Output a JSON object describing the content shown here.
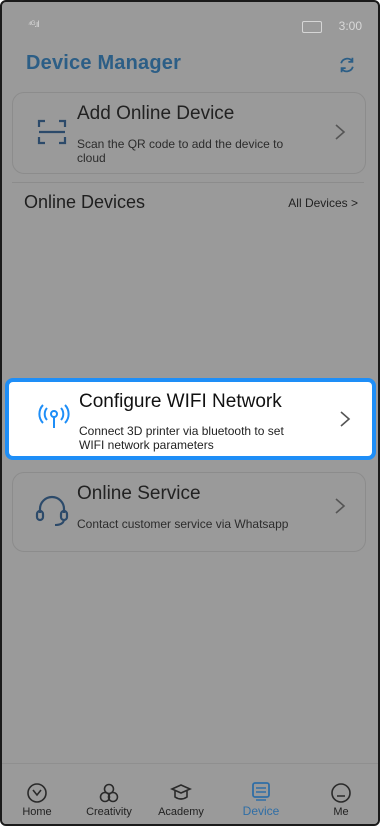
{
  "status_bar": {
    "signal": "⁴ᴳ.ıl",
    "time": "3:00"
  },
  "header": {
    "title": "Device Manager"
  },
  "add_device": {
    "title": "Add Online Device",
    "subtitle_line1": "Scan the QR code to add the device to",
    "subtitle_line2": "cloud"
  },
  "online_devices": {
    "title": "Online Devices",
    "link": "All Devices >"
  },
  "configure_wifi": {
    "title": "Configure WIFI Network",
    "subtitle_line1": "Connect 3D printer via bluetooth to set",
    "subtitle_line2": "WIFI network parameters"
  },
  "online_service": {
    "title": "Online Service",
    "subtitle": "Contact customer service via Whatsapp"
  },
  "tabs": [
    {
      "label": "Home",
      "icon": "home-icon"
    },
    {
      "label": "Creativity",
      "icon": "creativity-icon"
    },
    {
      "label": "Academy",
      "icon": "academy-icon"
    },
    {
      "label": "Device",
      "icon": "device-icon",
      "active": true
    },
    {
      "label": "Me",
      "icon": "me-icon"
    }
  ],
  "colors": {
    "accent": "#1e8ef7",
    "title": "#2c5e86",
    "active_tab": "#2f6ea6",
    "overlay": "#9a9a9a"
  }
}
